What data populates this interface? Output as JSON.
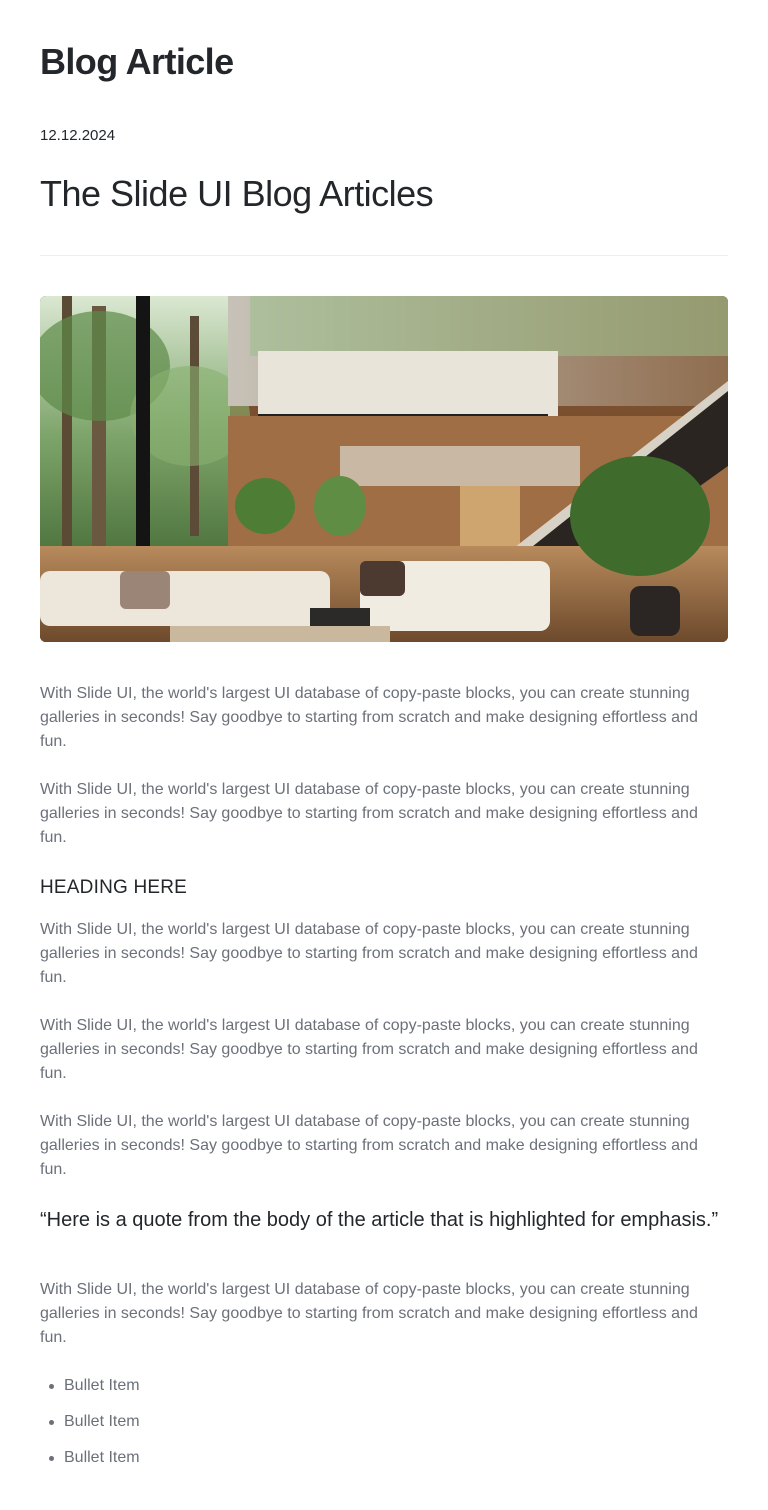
{
  "header": {
    "blog_title": "Blog Article",
    "date": "12.12.2024"
  },
  "article": {
    "title": "The Slide UI Blog Articles",
    "hero_image_icon": "modern-living-room-photo",
    "paragraphs": [
      "With Slide UI, the world's largest UI database of copy-paste blocks, you can create stunning galleries in seconds! Say goodbye to starting from scratch and make designing effortless and fun.",
      "With Slide UI, the world's largest UI database of copy-paste blocks, you can create stunning galleries in seconds! Say goodbye to starting from scratch and make designing effortless and fun.",
      "With Slide UI, the world's largest UI database of copy-paste blocks, you can create stunning galleries in seconds! Say goodbye to starting from scratch and make designing effortless and fun.",
      "With Slide UI, the world's largest UI database of copy-paste blocks, you can create stunning galleries in seconds! Say goodbye to starting from scratch and make designing effortless and fun.",
      "With Slide UI, the world's largest UI database of copy-paste blocks, you can create stunning galleries in seconds! Say goodbye to starting from scratch and make designing effortless and fun.",
      "With Slide UI, the world's largest UI database of copy-paste blocks, you can create stunning galleries in seconds! Say goodbye to starting from scratch and make designing effortless and fun."
    ],
    "section_heading": "HEADING HERE",
    "quote": "“Here is a quote from the body of the article that is highlighted for emphasis.”",
    "bullets": [
      "Bullet Item",
      "Bullet Item",
      "Bullet Item"
    ]
  },
  "colors": {
    "heading": "#23272b",
    "body_text": "#6b7079",
    "divider": "#eceef0"
  }
}
